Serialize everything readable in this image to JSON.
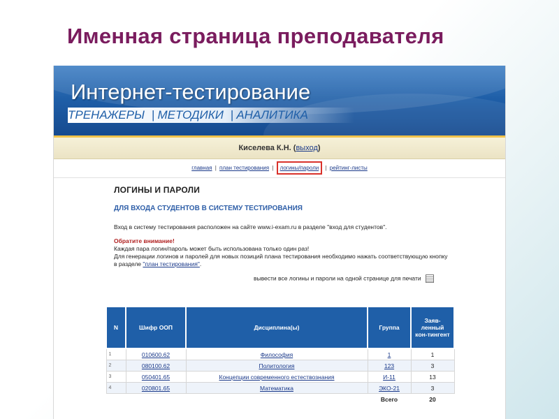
{
  "slide": {
    "title": "Именная страница преподавателя"
  },
  "banner": {
    "brand": "Интернет-тестирование",
    "nav": [
      "ТРЕНАЖЕРЫ",
      "МЕТОДИКИ",
      "АНАЛИТИКА"
    ]
  },
  "user": {
    "name": "Киселева К.Н.",
    "logout_open": "(",
    "logout_label": "выход",
    "logout_close": ")"
  },
  "menu": {
    "items": [
      "главная",
      "план тестирования",
      "логины/пароли",
      "рейтинг-листы"
    ],
    "separator": "|"
  },
  "page": {
    "heading": "ЛОГИНЫ И ПАРОЛИ",
    "subheading": "ДЛЯ ВХОДА СТУДЕНТОВ В СИСТЕМУ ТЕСТИРОВАНИЯ",
    "intro": "Вход в систему тестирования расположен на сайте www.i-exam.ru в разделе \"вход для студентов\".",
    "attention": "Обратите внимание!",
    "note1": "Каждая пара логин/пароль может быть использована только один раз!",
    "note2": "Для генерации логинов и паролей для новых позиций плана тестирования необходимо нажать соответствующую кнопку в разделе",
    "plan_link": "\"план тестирования\"",
    "plan_tail": ".",
    "print_label": "вывести все логины и пароли на одной странице для печати"
  },
  "table": {
    "headers": [
      "N",
      "Шифр ООП",
      "Дисциплина(ы)",
      "Группа",
      "Заяв-ленный кон-тингент"
    ],
    "rows": [
      {
        "n": "1",
        "code": "010600.62",
        "discipline": "Философия",
        "group": "1",
        "count": "1"
      },
      {
        "n": "2",
        "code": "080100.62",
        "discipline": "Политология",
        "group": "123",
        "count": "3"
      },
      {
        "n": "3",
        "code": "050401.65",
        "discipline": "Концепции современного естествознания",
        "group": "И-11",
        "count": "13"
      },
      {
        "n": "4",
        "code": "020801.65",
        "discipline": "Математика",
        "group": "ЭКО-21",
        "count": "3"
      }
    ],
    "total_label": "Всего",
    "total_value": "20"
  }
}
